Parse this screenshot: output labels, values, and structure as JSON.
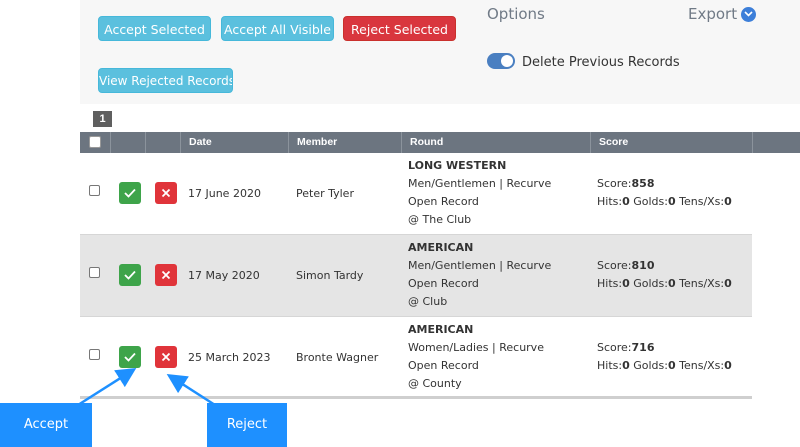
{
  "toolbar": {
    "accept_selected": "Accept Selected",
    "accept_all_visible": "Accept All Visible",
    "reject_selected": "Reject Selected",
    "view_rejected_records": "View Rejected Records"
  },
  "options": {
    "title": "Options",
    "export_label": "Export",
    "export_icon": "chevron-down-icon",
    "delete_previous_label": "Delete Previous Records",
    "delete_previous_on": true
  },
  "pagination": {
    "current_page": "1"
  },
  "table": {
    "columns": {
      "date": "Date",
      "member": "Member",
      "round": "Round",
      "score": "Score"
    },
    "rows": [
      {
        "date": "17 June 2020",
        "member": "Peter Tyler",
        "round_name": "LONG WESTERN",
        "round_class": "Men/Gentlemen | Recurve",
        "record_type": "Open Record",
        "location": "@ The Club",
        "score_label": "Score:",
        "score": "858",
        "hits_label": "Hits:",
        "hits": "0",
        "golds_label": "Golds:",
        "golds": "0",
        "tens_label": "Tens/Xs:",
        "tens": "0"
      },
      {
        "date": "17 May 2020",
        "member": "Simon Tardy",
        "round_name": "AMERICAN",
        "round_class": "Men/Gentlemen | Recurve",
        "record_type": "Open Record",
        "location": "@ Club",
        "score_label": "Score:",
        "score": "810",
        "hits_label": "Hits:",
        "hits": "0",
        "golds_label": "Golds:",
        "golds": "0",
        "tens_label": "Tens/Xs:",
        "tens": "0"
      },
      {
        "date": "25 March 2023",
        "member": "Bronte Wagner",
        "round_name": "AMERICAN",
        "round_class": "Women/Ladies | Recurve",
        "record_type": "Open Record",
        "location": "@ County",
        "score_label": "Score:",
        "score": "716",
        "hits_label": "Hits:",
        "hits": "0",
        "golds_label": "Golds:",
        "golds": "0",
        "tens_label": "Tens/Xs:",
        "tens": "0"
      }
    ]
  },
  "callouts": {
    "accept": "Accept",
    "reject": "Reject"
  },
  "colors": {
    "accept_green": "#3ea44a",
    "reject_red": "#e0343a",
    "teal_button": "#5bc0de",
    "header_gray": "#6c7580",
    "callout_blue": "#1e90ff"
  }
}
